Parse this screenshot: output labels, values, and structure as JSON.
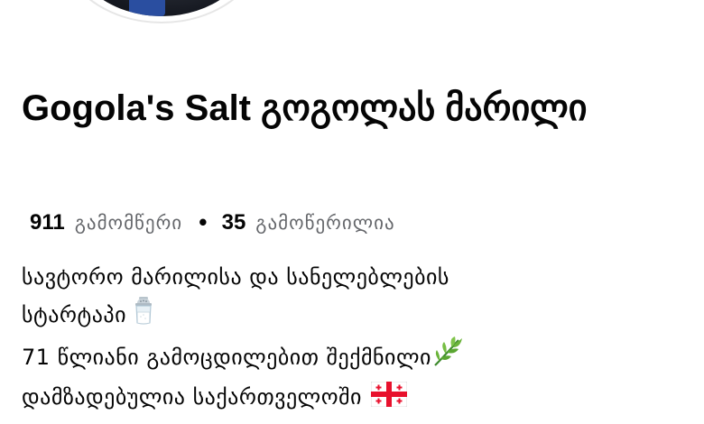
{
  "profile": {
    "name": "Gogola's Salt გოგოლას მარილი",
    "avatar_icon": "profile-photo",
    "stats": {
      "followers_count": "911",
      "followers_label": "გამომწერი",
      "separator": "•",
      "following_count": "35",
      "following_label": "გამოწერილია"
    },
    "bio": {
      "line1": "სავტორო მარილისა და სანელებლების",
      "line2": "სტარტაპი",
      "line2_icon": "salt-shaker-icon",
      "line3": "71 წლიანი გამოცდილებით შექმნილი",
      "line3_icon": "herb-icon",
      "line4": "დამზადებულია საქართველოში",
      "line4_icon": "georgia-flag-icon"
    }
  },
  "colors": {
    "text_primary": "#050505",
    "text_secondary": "#65676b",
    "background": "#ffffff"
  }
}
